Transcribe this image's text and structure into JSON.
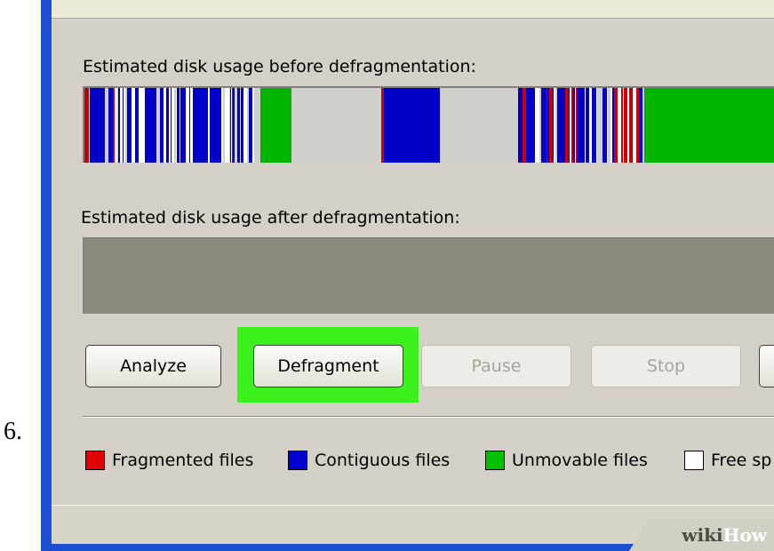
{
  "step_number": "6.",
  "defrag": {
    "before_label": "Estimated disk usage before defragmentation:",
    "after_label": "Estimated disk usage after defragmentation:",
    "before_segments": [
      {
        "start": 0,
        "end": 198,
        "pattern": "mixed"
      },
      {
        "start": 198,
        "end": 233,
        "color": "#00b400"
      },
      {
        "start": 233,
        "end": 334,
        "color": "#d0cfcc"
      },
      {
        "start": 334,
        "end": 337,
        "color": "#cc0000"
      },
      {
        "start": 337,
        "end": 400,
        "color": "#0000c8"
      },
      {
        "start": 400,
        "end": 488,
        "color": "#d0cfcc"
      },
      {
        "start": 488,
        "end": 630,
        "pattern": "mixed"
      },
      {
        "start": 630,
        "end": 778,
        "color": "#00b400"
      }
    ],
    "after_fill": "#8b8a7c"
  },
  "buttons": {
    "analyze": "Analyze",
    "defragment": "Defragment",
    "pause": "Pause",
    "stop": "Stop"
  },
  "legend": {
    "fragmented": {
      "label": "Fragmented files",
      "color": "#e00000"
    },
    "contiguous": {
      "label": "Contiguous files",
      "color": "#0000d0"
    },
    "unmovable": {
      "label": "Unmovable files",
      "color": "#00c000"
    },
    "free": {
      "label": "Free sp",
      "color": "#ffffff"
    }
  },
  "watermark": {
    "part1": "wiki",
    "part2": "How"
  },
  "colors": {
    "highlight": "#3cf01e",
    "window_bg": "#d4d0c8",
    "frame_blue": "#1f4fd1"
  }
}
